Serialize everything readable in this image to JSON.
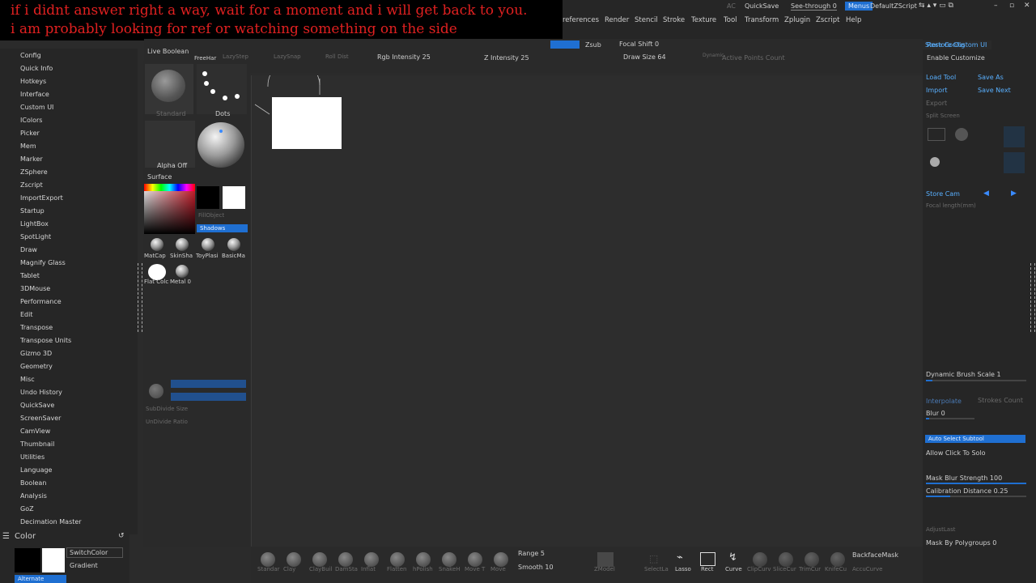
{
  "overlay": {
    "line1": "if i didnt answer right a way, wait for a moment and i will get back to you.",
    "line2": "i am probably looking for ref or watching something on the side"
  },
  "top": {
    "ac": "AC",
    "quicksave": "QuickSave",
    "see_through": "See-through",
    "see_through_value": "0",
    "menus": "Menus",
    "default_zscript": "DefaultZScript",
    "menu_items": [
      "references",
      "Render",
      "Stencil",
      "Stroke",
      "Texture",
      "Tool",
      "Transform",
      "Zplugin",
      "Zscript",
      "Help"
    ]
  },
  "toolstrip": {
    "live_boolean": "Live Boolean",
    "freehand": "FreeHar",
    "lazystep": "LazyStep",
    "lazysnap": "LazySnap",
    "roll_dist": "Roll Dist",
    "rgb_intensity": "Rgb Intensity 25",
    "z_intensity": "Z Intensity 25",
    "zsub": "Zsub",
    "focal_shift": "Focal Shift 0",
    "draw_size": "Draw Size 64",
    "dynamic": "Dynamic",
    "active_points": "Active Points Count"
  },
  "left_list": [
    "Config",
    "Quick Info",
    "Hotkeys",
    "Interface",
    "Custom UI",
    "IColors",
    "Picker",
    "Mem",
    "Marker",
    "ZSphere",
    "Zscript",
    "ImportExport",
    "Startup",
    "LightBox",
    "SpotLight",
    "Draw",
    "Magnify Glass",
    "Tablet",
    "3DMouse",
    "Performance",
    "Edit",
    "Transpose",
    "Transpose Units",
    "Gizmo 3D",
    "Geometry",
    "Misc",
    "Undo History",
    "QuickSave",
    "ScreenSaver",
    "CamView",
    "Thumbnail",
    "Utilities",
    "Language",
    "Boolean",
    "Analysis",
    "GoZ",
    "Decimation Master"
  ],
  "color_panel": {
    "title": "Color",
    "switch_color": "SwitchColor",
    "gradient": "Gradient",
    "alternate": "Alternate"
  },
  "palette": {
    "standard": "Standard",
    "dots": "Dots",
    "alpha_off": "Alpha Off",
    "surface": "Surface",
    "fill_object": "FillObject",
    "shadows": "Shadows",
    "materials": [
      "MatCap",
      "SkinSha",
      "ToyPlasi",
      "BasicMa"
    ],
    "materials2": [
      "Flat Colc",
      "Metal 0"
    ],
    "subdivide_size": "SubDivide Size",
    "undivide_ratio": "UnDivide Ratio"
  },
  "right_tray": {
    "store_config": "Store Config",
    "restore_custom_ui": "Restore Custom UI",
    "enable_customize": "Enable Customize",
    "load_tool": "Load Tool",
    "save_as": "Save As",
    "import": "Import",
    "save_next": "Save Next",
    "export": "Export",
    "split_screen": "Split Screen",
    "store_cam": "Store Cam",
    "focal_length": "Focal length(mm)",
    "dynamic_brush_scale": "Dynamic Brush Scale 1",
    "interpolate": "Interpolate",
    "strokes_count": "Strokes Count",
    "blur": "Blur 0",
    "auto_select_subtool": "Auto Select Subtool",
    "allow_click_to_solo": "Allow Click To Solo",
    "mask_blur_strength": "Mask Blur Strength 100",
    "calibration_distance": "Calibration Distance 0.25",
    "adjust_last": "AdjustLast",
    "mask_by_polygroups": "Mask By Polygroups 0"
  },
  "bottom": {
    "brushes": [
      "Standar",
      "Clay",
      "ClayBuil",
      "DamSta",
      "Inflat",
      "Flatten",
      "hPolish",
      "SnakeH",
      "Move T",
      "Move"
    ],
    "range": "Range 5",
    "smooth": "Smooth 10",
    "zmodel": "ZModel",
    "select": "SelectLa",
    "lasso": "Lasso",
    "rect": "Rect",
    "curve": "Curve",
    "clip_tools": [
      "ClipCurv",
      "SliceCur",
      "TrimCur",
      "KnifeCu"
    ],
    "backface_mask": "BackfaceMask",
    "accucurve": "AccuCurve"
  }
}
